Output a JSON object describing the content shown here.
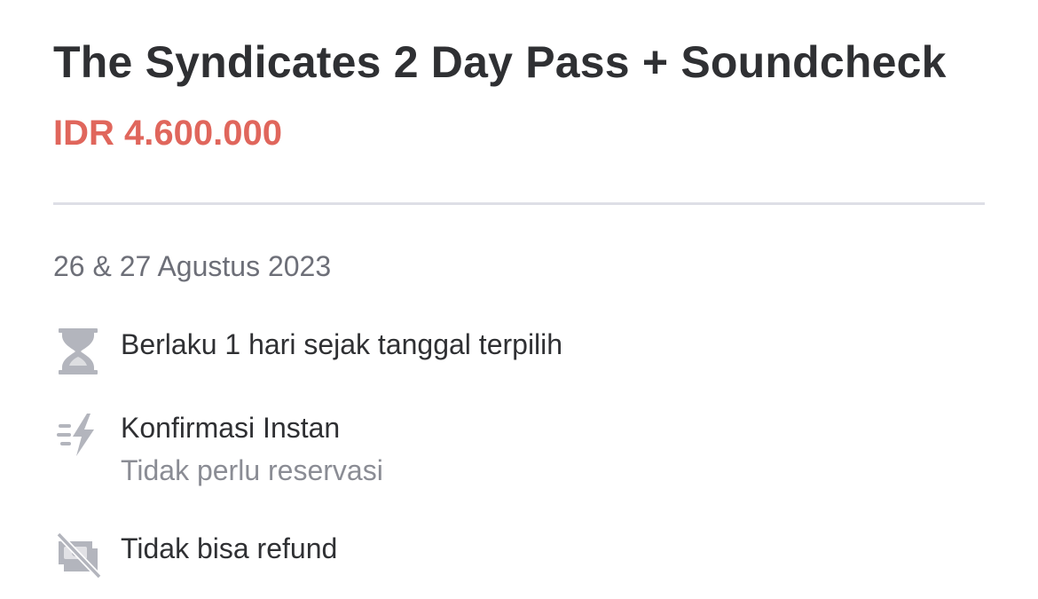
{
  "product": {
    "title": "The Syndicates 2 Day Pass + Soundcheck",
    "price": "IDR 4.600.000",
    "date": "26 & 27 Agustus 2023"
  },
  "features": [
    {
      "icon": "hourglass-icon",
      "label": "Berlaku 1 hari sejak tanggal terpilih"
    },
    {
      "icon": "lightning-icon",
      "label": "Konfirmasi Instan",
      "sublabel": "Tidak perlu reservasi"
    },
    {
      "icon": "no-refund-icon",
      "label": "Tidak bisa refund"
    }
  ],
  "colors": {
    "title": "#2f3033",
    "price": "#e0665c",
    "muted": "#8a8c94",
    "icon": "#b3b5bd",
    "divider": "#dedfe6"
  }
}
